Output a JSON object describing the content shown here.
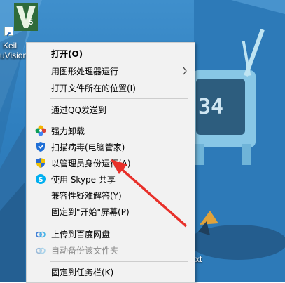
{
  "desktop": {
    "shortcut_label_line1": "Keil",
    "shortcut_label_line2": "uVision",
    "logo_text": "5",
    "bg_text": "34",
    "partial_right_label": "xt"
  },
  "context_menu": {
    "items": [
      {
        "label": "打开(O)",
        "bold": true
      },
      {
        "label": "用图形处理器运行",
        "submenu": true
      },
      {
        "label": "打开文件所在的位置(I)"
      },
      {
        "label": "通过QQ发送到"
      },
      {
        "label": "强力卸载",
        "icon": "pinwheel-icon"
      },
      {
        "label": "扫描病毒(电脑管家)",
        "icon": "shield-icon"
      },
      {
        "label": "以管理员身份运行(A)",
        "icon": "uac-shield-icon"
      },
      {
        "label": "使用 Skype 共享",
        "icon": "skype-icon"
      },
      {
        "label": "兼容性疑难解答(Y)"
      },
      {
        "label": "固定到\"开始\"屏幕(P)"
      },
      {
        "label": "上传到百度网盘",
        "icon": "baidu-cloud-icon"
      },
      {
        "label": "自动备份该文件夹",
        "icon": "baidu-cloud-icon",
        "disabled": true
      },
      {
        "label": "固定到任务栏(K)"
      }
    ]
  },
  "colors": {
    "menu_bg": "#f2f2f2",
    "arrow": "#e8302a",
    "desktop": "#3f8fcc"
  }
}
